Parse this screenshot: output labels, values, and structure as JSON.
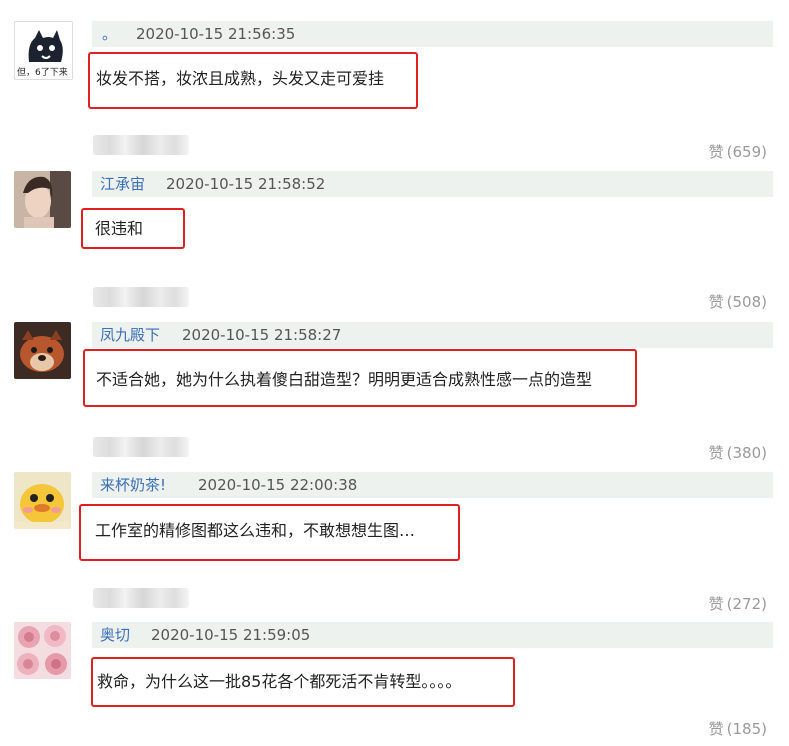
{
  "colors": {
    "username": "#3b6fb6",
    "highlight_box": "#e02020",
    "meta_bar": "#eef2ef",
    "like": "#9a9a9a"
  },
  "like_label": "赞",
  "comments": [
    {
      "username": "。",
      "timestamp": "2020-10-15 21:56:35",
      "text": "妆发不搭，妆浓且成熟，头发又走可爱挂",
      "likes": "(659)",
      "avatar": "cartoon-cat-avatar",
      "avatar_caption": "但，6了下来"
    },
    {
      "username": "江承宙",
      "timestamp": "2020-10-15 21:58:52",
      "text": "很违和",
      "likes": "(508)",
      "avatar": "photo-woman-avatar"
    },
    {
      "username": "凤九殿下",
      "timestamp": "2020-10-15 21:58:27",
      "text": "不适合她，她为什么执着傻白甜造型？明明更适合成熟性感一点的造型",
      "likes": "(380)",
      "avatar": "fox-avatar"
    },
    {
      "username": "来杯奶茶!",
      "timestamp": "2020-10-15 22:00:38",
      "text": "工作室的精修图都这么违和，不敢想想生图…",
      "likes": "(272)",
      "avatar": "yellow-duck-avatar"
    },
    {
      "username": "奥切",
      "timestamp": "2020-10-15 21:59:05",
      "text": "救命，为什么这一批85花各个都死活不肯转型。。。。",
      "likes": "(185)",
      "avatar": "pink-roses-avatar"
    }
  ]
}
